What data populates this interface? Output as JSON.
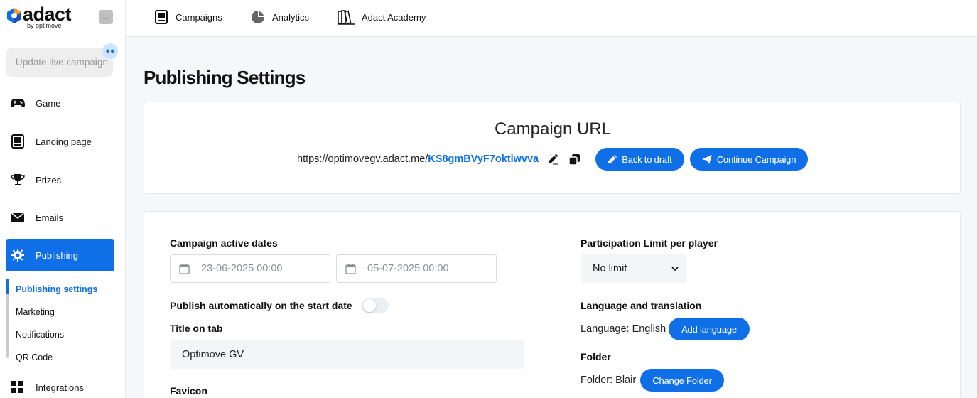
{
  "brand": {
    "name": "adact",
    "sub": "by optimove",
    "accent": "#0f6fe6"
  },
  "sidebar": {
    "update_live": "Update live campaign",
    "items": [
      {
        "label": "Game",
        "icon": "gamepad-icon"
      },
      {
        "label": "Landing page",
        "icon": "landing-page-icon"
      },
      {
        "label": "Prizes",
        "icon": "trophy-icon"
      },
      {
        "label": "Emails",
        "icon": "envelope-icon"
      },
      {
        "label": "Publishing",
        "icon": "gear-icon"
      },
      {
        "label": "Integrations",
        "icon": "grid-icon"
      }
    ],
    "subitems": [
      {
        "label": "Publishing settings"
      },
      {
        "label": "Marketing"
      },
      {
        "label": "Notifications"
      },
      {
        "label": "QR Code"
      }
    ]
  },
  "topnav": {
    "tabs": [
      {
        "label": "Campaigns",
        "icon": "campaigns-icon"
      },
      {
        "label": "Analytics",
        "icon": "pie-chart-icon"
      },
      {
        "label": "Adact Academy",
        "icon": "books-icon"
      }
    ]
  },
  "page": {
    "title": "Publishing Settings"
  },
  "campaign_url": {
    "title": "Campaign URL",
    "base": "https://optimovegv.adact.me/",
    "slug": "KS8gmBVyF7oktiwvva",
    "back_to_draft": "Back to draft",
    "continue": "Continue Campaign"
  },
  "settings": {
    "active_dates_label": "Campaign active dates",
    "start_date": "23-06-2025 00:00",
    "end_date": "05-07-2025 00:00",
    "publish_auto_label": "Publish automatically on the start date",
    "title_on_tab_label": "Title on tab",
    "title_on_tab_value": "Optimove GV",
    "favicon_label": "Favicon",
    "participation_label": "Participation Limit per player",
    "participation_value": "No limit",
    "language_label": "Language and translation",
    "language_text": "Language: English",
    "add_language": "Add language",
    "folder_label": "Folder",
    "folder_text": "Folder: Blair",
    "change_folder": "Change Folder"
  }
}
